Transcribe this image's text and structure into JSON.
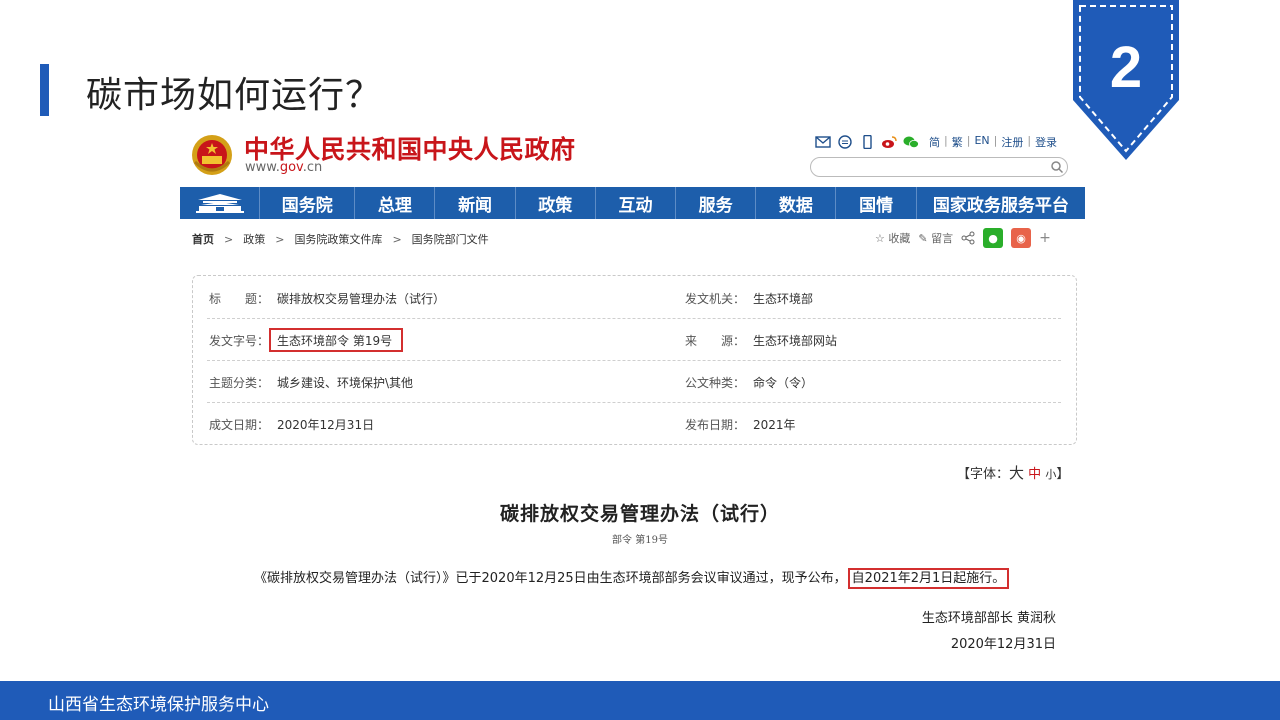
{
  "slide": {
    "title": "碳市场如何运行？",
    "badge_number": "2",
    "footer_text": "山西省生态环境保护服务中心",
    "accent_color": "#1f5bb8"
  },
  "site": {
    "name": "中华人民共和国中央人民政府",
    "url_prefix": "www.",
    "url_brand": "gov",
    "url_suffix": ".cn",
    "top_links": [
      "简",
      "繁",
      "EN",
      "注册",
      "登录"
    ],
    "header_icons": [
      "mail-icon",
      "chat-icon",
      "mobile-icon",
      "weibo-icon",
      "wechat-icon"
    ],
    "brand_red": "#c8151a",
    "nav_blue": "#1d5eab"
  },
  "nav": {
    "items": [
      "国务院",
      "总理",
      "新闻",
      "政策",
      "互动",
      "服务",
      "数据",
      "国情",
      "国家政务服务平台"
    ]
  },
  "breadcrumb": {
    "items": [
      "首页",
      "政策",
      "国务院政策文件库",
      "国务院部门文件"
    ],
    "tools": [
      "收藏",
      "留言"
    ]
  },
  "info": {
    "rows": [
      {
        "l1": "标　　题：",
        "v1": "碳排放权交易管理办法（试行）",
        "l2": "发文机关：",
        "v2": "生态环境部"
      },
      {
        "l1": "发文字号：",
        "v1": "生态环境部令 第19号",
        "l2": "来　　源：",
        "v2": "生态环境部网站"
      },
      {
        "l1": "主题分类：",
        "v1": "城乡建设、环境保护\\其他",
        "l2": "公文种类：",
        "v2": "命令（令）"
      },
      {
        "l1": "成文日期：",
        "v1": "2020年12月31日",
        "l2": "发布日期：",
        "v2": "2021年"
      }
    ]
  },
  "font_ctrl": {
    "prefix": "【字体：",
    "large": "大",
    "medium": "中",
    "small": "小",
    "suffix": "】"
  },
  "doc": {
    "title": "碳排放权交易管理办法（试行）",
    "subtitle": "部令 第19号",
    "body_main": "《碳排放权交易管理办法（试行）》已于2020年12月25日由生态环境部部务会议审议通过，现予公布，",
    "body_highlight": "自2021年2月1日起施行。",
    "signature": "生态环境部部长 黄润秋",
    "date": "2020年12月31日"
  }
}
